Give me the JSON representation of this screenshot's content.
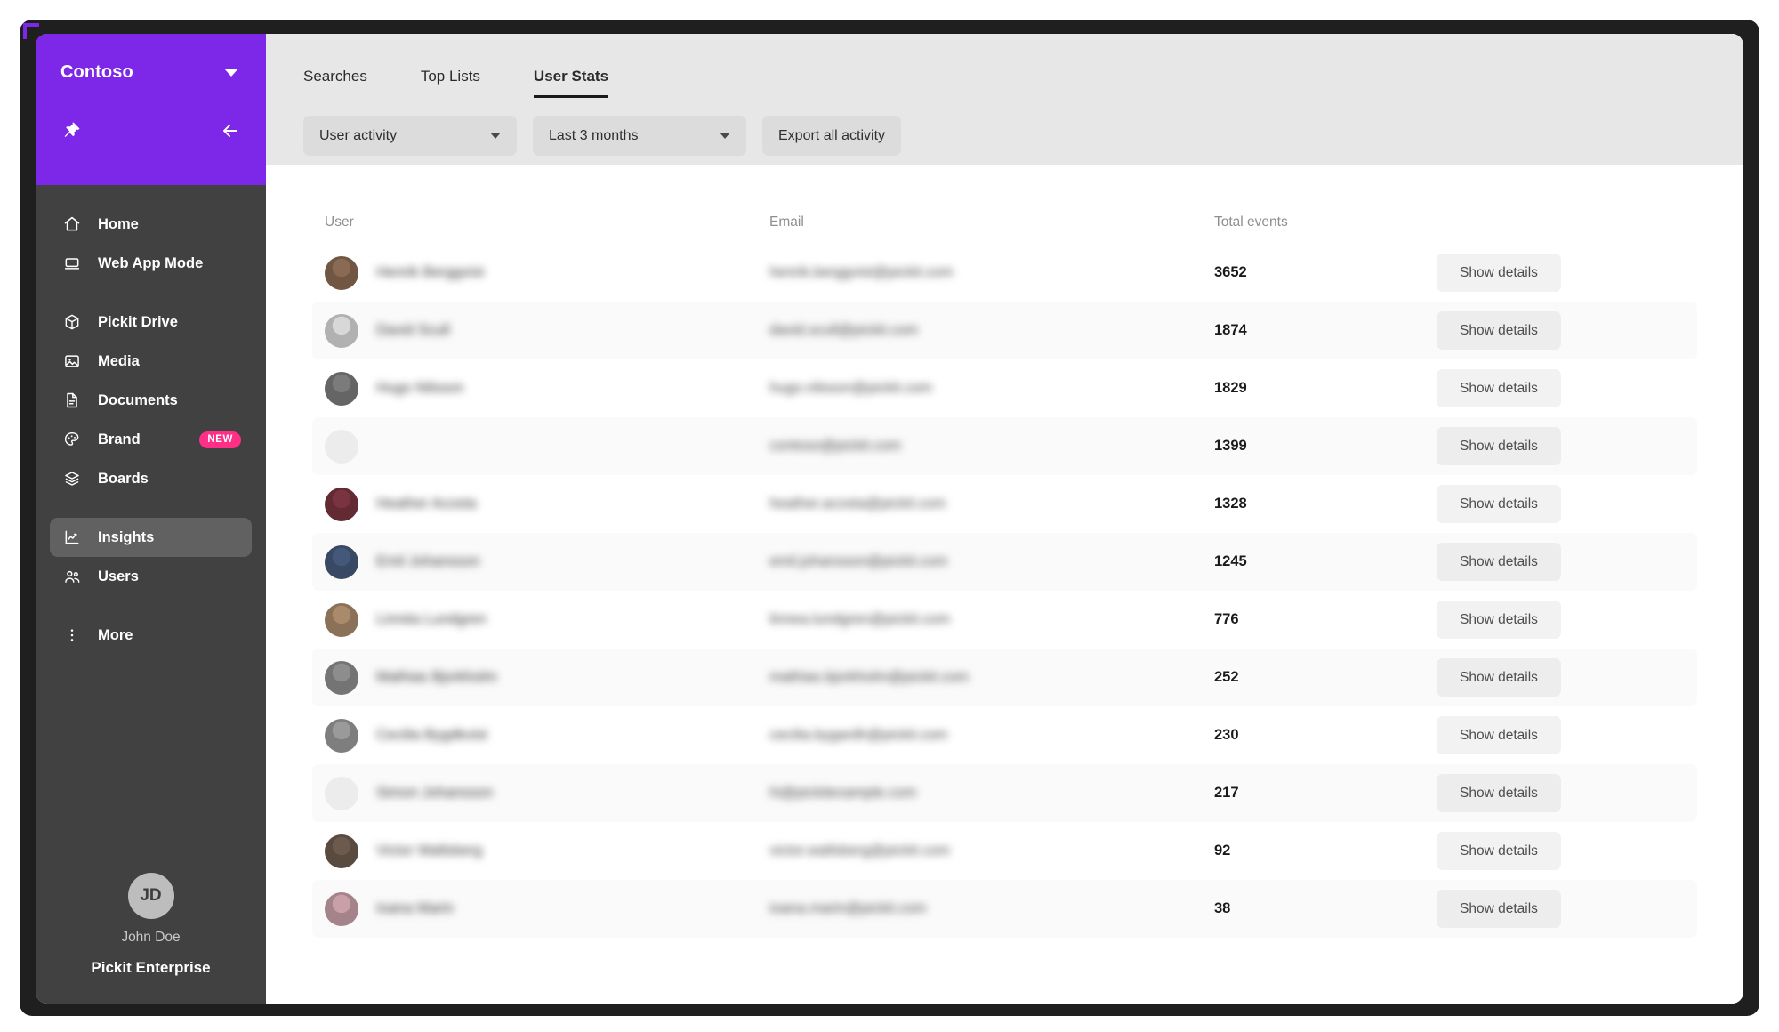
{
  "sidebar": {
    "org": {
      "name": "Contoso",
      "chevron_icon": "chevron-down-icon",
      "pin_icon": "pin-icon",
      "collapse_icon": "arrow-left-icon",
      "color": "#7d27e8"
    },
    "items": [
      {
        "label": "Home",
        "icon": "home-icon",
        "active": false,
        "badge": ""
      },
      {
        "label": "Web App Mode",
        "icon": "laptop-icon",
        "active": false,
        "badge": ""
      },
      {
        "label": "Pickit Drive",
        "icon": "cube-icon",
        "active": false,
        "badge": ""
      },
      {
        "label": "Media",
        "icon": "image-icon",
        "active": false,
        "badge": ""
      },
      {
        "label": "Documents",
        "icon": "document-icon",
        "active": false,
        "badge": ""
      },
      {
        "label": "Brand",
        "icon": "palette-icon",
        "active": false,
        "badge": "NEW"
      },
      {
        "label": "Boards",
        "icon": "layers-icon",
        "active": false,
        "badge": ""
      },
      {
        "label": "Insights",
        "icon": "chart-line-icon",
        "active": true,
        "badge": ""
      },
      {
        "label": "Users",
        "icon": "people-icon",
        "active": false,
        "badge": ""
      },
      {
        "label": "More",
        "icon": "dots-vertical-icon",
        "active": false,
        "badge": ""
      }
    ],
    "badge_color": "#ff2e87",
    "profile": {
      "initials": "JD",
      "name": "John Doe",
      "plan": "Pickit Enterprise"
    }
  },
  "main": {
    "tabs": [
      {
        "label": "Searches",
        "active": false
      },
      {
        "label": "Top Lists",
        "active": false
      },
      {
        "label": "User Stats",
        "active": true
      }
    ],
    "filters": {
      "metric": {
        "value": "User activity",
        "icon": "chevron-down-icon"
      },
      "period": {
        "value": "Last 3 months",
        "icon": "chevron-down-icon"
      },
      "export_label": "Export all activity"
    },
    "table": {
      "columns": [
        "User",
        "Email",
        "Total events",
        ""
      ],
      "action_label": "Show details",
      "rows": [
        {
          "name": "Henrik Berggvist",
          "email": "henrik.berggvist@pickit.com",
          "total": "3652",
          "avatar": "photo",
          "avatar_color": "#8a6a52"
        },
        {
          "name": "David Scull",
          "email": "david.scull@pickit.com",
          "total": "1874",
          "avatar": "photo",
          "avatar_color": "#d8d8d8"
        },
        {
          "name": "Hugo Nilsson",
          "email": "hugo.nilsson@pickit.com",
          "total": "1829",
          "avatar": "photo",
          "avatar_color": "#7b7b7b"
        },
        {
          "name": "",
          "email": "contoso@pickit.com",
          "total": "1399",
          "avatar": "placeholder",
          "avatar_color": "#ececec"
        },
        {
          "name": "Heather Acosta",
          "email": "heather.acosta@pickit.com",
          "total": "1328",
          "avatar": "photo",
          "avatar_color": "#7a3340"
        },
        {
          "name": "Emil Johansson",
          "email": "emil.johansson@pickit.com",
          "total": "1245",
          "avatar": "photo",
          "avatar_color": "#44597a"
        },
        {
          "name": "Linnéa Lundgren",
          "email": "linnea.lundgren@pickit.com",
          "total": "776",
          "avatar": "photo",
          "avatar_color": "#a98a6a"
        },
        {
          "name": "Mathias Bjorkholm",
          "email": "mathias.bjorkholm@pickit.com",
          "total": "252",
          "avatar": "photo",
          "avatar_color": "#8d8d8d"
        },
        {
          "name": "Cecilia Bygdkvist",
          "email": "cecilia.bygardh@pickit.com",
          "total": "230",
          "avatar": "photo",
          "avatar_color": "#9a9a9a"
        },
        {
          "name": "Simon Johansson",
          "email": "hi@pickitexample.com",
          "total": "217",
          "avatar": "placeholder",
          "avatar_color": "#ececec"
        },
        {
          "name": "Victor Wallsberg",
          "email": "victor.wallsberg@pickit.com",
          "total": "92",
          "avatar": "photo",
          "avatar_color": "#6d5a4e"
        },
        {
          "name": "Ioana Marin",
          "email": "ioana.marin@pickit.com",
          "total": "38",
          "avatar": "photo",
          "avatar_color": "#c9a0a8"
        }
      ]
    }
  }
}
